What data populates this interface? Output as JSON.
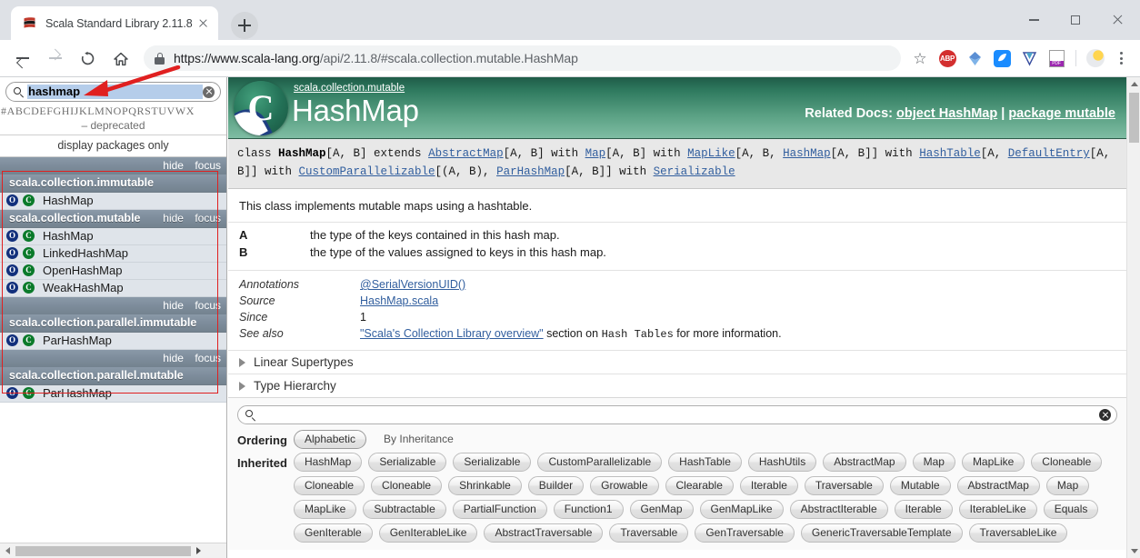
{
  "browser": {
    "tab": {
      "title": "Scala Standard Library 2.11.8 -",
      "favicon": "scala-logo-icon",
      "close": "close-icon"
    },
    "newtab_label": "new-tab-icon",
    "window_controls": {
      "minimize": "minimize-icon",
      "maximize": "maximize-icon",
      "close": "close-icon"
    },
    "nav": {
      "back": "back-arrow-icon",
      "forward": "forward-arrow-icon",
      "reload": "reload-icon",
      "home": "home-icon"
    },
    "omnibox": {
      "secure_icon": "lock-icon",
      "url_main": "https://www.scala-lang.org",
      "url_dim": "/api/2.11.8/#scala.collection.mutable.HashMap"
    },
    "extensions": [
      "bookmark-star-icon",
      "abp-icon",
      "diamond-icon",
      "blue-app-icon",
      "v-icon",
      "pdf-icon",
      "weather-icon",
      "kebab-menu-icon"
    ],
    "abp_label": "ABP",
    "pdf_label": "PDF"
  },
  "sidebar": {
    "search": {
      "value": "hashmap",
      "icon": "search-icon",
      "clear": "clear-icon"
    },
    "alphabet": "#ABCDEFGHIJKLMNOPQRSTUVWX",
    "deprecated_label": "– deprecated",
    "packages_only_label": "display packages only",
    "actions": {
      "hide": "hide",
      "focus": "focus"
    },
    "groups": [
      {
        "package": "scala.collection.immutable",
        "inline_actions": false,
        "entries": [
          {
            "name": "HashMap",
            "icons": [
              "object-icon",
              "class-icon"
            ]
          }
        ]
      },
      {
        "package": "scala.collection.mutable",
        "inline_actions": true,
        "entries": [
          {
            "name": "HashMap",
            "icons": [
              "object-icon",
              "class-icon"
            ]
          },
          {
            "name": "LinkedHashMap",
            "icons": [
              "object-icon",
              "class-icon"
            ]
          },
          {
            "name": "OpenHashMap",
            "icons": [
              "object-icon",
              "class-icon"
            ]
          },
          {
            "name": "WeakHashMap",
            "icons": [
              "object-icon",
              "class-icon"
            ]
          }
        ]
      },
      {
        "package": "scala.collection.parallel.immutable",
        "inline_actions": false,
        "entries": [
          {
            "name": "ParHashMap",
            "icons": [
              "object-icon",
              "class-icon"
            ]
          }
        ]
      },
      {
        "package": "scala.collection.parallel.mutable",
        "inline_actions": false,
        "entries": [
          {
            "name": "ParHashMap",
            "icons": [
              "object-icon",
              "class-icon"
            ]
          }
        ]
      }
    ]
  },
  "doc": {
    "package_path": "scala.collection.mutable",
    "title": "HashMap",
    "related_label": "Related Docs:",
    "related_links": [
      "object HashMap",
      "package mutable"
    ],
    "related_sep": "|",
    "signature": {
      "keyword_class": "class",
      "name": "HashMap",
      "text": "class HashMap[A, B] extends AbstractMap[A, B] with Map[A, B] with MapLike[A, B, HashMap[A, B]] with HashTable[A, DefaultEntry[A, B]] with CustomParallelizable[(A, B), ParHashMap[A, B]] with Serializable"
    },
    "comment": "This class implements mutable maps using a hashtable.",
    "params": [
      {
        "name": "A",
        "desc": "the type of the keys contained in this hash map."
      },
      {
        "name": "B",
        "desc": "the type of the values assigned to keys in this hash map."
      }
    ],
    "attributes": [
      {
        "key": "Annotations",
        "value": "@SerialVersionUID()",
        "link": true
      },
      {
        "key": "Source",
        "value": "HashMap.scala",
        "link": true
      },
      {
        "key": "Since",
        "value": "1",
        "link": false
      },
      {
        "key": "See also",
        "value": "\"Scala's Collection Library overview\"",
        "link": true,
        "suffix_a": " section on ",
        "suffix_mono": "Hash Tables",
        "suffix_b": " for more information."
      }
    ],
    "toggles": [
      {
        "label": "Linear Supertypes",
        "icon": "triangle-right-icon"
      },
      {
        "label": "Type Hierarchy",
        "icon": "triangle-right-icon"
      }
    ]
  },
  "members": {
    "search": {
      "value": "",
      "placeholder": "",
      "icon": "search-icon",
      "clear": "clear-icon"
    },
    "ordering_label": "Ordering",
    "ordering_options": [
      "Alphabetic",
      "By Inheritance"
    ],
    "ordering_selected": "Alphabetic",
    "inherited_label": "Inherited",
    "inherited": [
      "HashMap",
      "Serializable",
      "Serializable",
      "CustomParallelizable",
      "HashTable",
      "HashUtils",
      "AbstractMap",
      "Map",
      "MapLike",
      "Cloneable",
      "Cloneable",
      "Cloneable",
      "Shrinkable",
      "Builder",
      "Growable",
      "Clearable",
      "Iterable",
      "Traversable",
      "Mutable",
      "AbstractMap",
      "Map",
      "MapLike",
      "Subtractable",
      "PartialFunction",
      "Function1",
      "GenMap",
      "GenMapLike",
      "AbstractIterable",
      "Iterable",
      "IterableLike",
      "Equals",
      "GenIterable",
      "GenIterableLike",
      "AbstractTraversable",
      "Traversable",
      "GenTraversable",
      "GenericTraversableTemplate",
      "TraversableLike"
    ]
  },
  "annotations": {
    "box_color": "#e02020",
    "arrow_color": "#e02020"
  }
}
